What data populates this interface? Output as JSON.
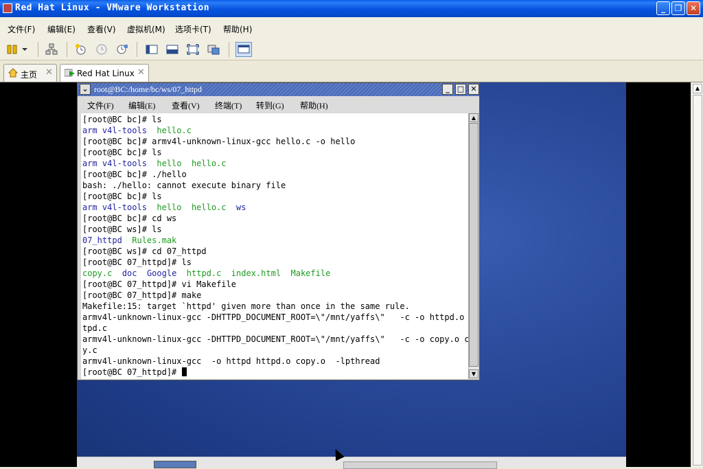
{
  "window": {
    "title": "Red Hat Linux - VMware Workstation",
    "minimize": "_",
    "maximize": "❐",
    "close": "✕"
  },
  "menubar": [
    "文件(F)",
    "编辑(E)",
    "查看(V)",
    "虚拟机(M)",
    "选项卡(T)",
    "帮助(H)"
  ],
  "tabs": [
    {
      "label": "主页",
      "icon": "home-icon",
      "close": "✕"
    },
    {
      "label": "Red Hat Linux",
      "icon": "play-icon",
      "close": "✕"
    }
  ],
  "terminal": {
    "title": "root@BC:/home/bc/ws/07_httpd",
    "menu": [
      "文件(F)",
      "编辑(E)",
      "查看(V)",
      "终端(T)",
      "转到(G)",
      "帮助(H)"
    ],
    "lines": [
      [
        {
          "t": "[root@BC bc]# ls",
          "c": ""
        }
      ],
      [
        {
          "t": "arm v4l-tools",
          "c": "dir"
        },
        {
          "t": "  ",
          "c": ""
        },
        {
          "t": "hello.c",
          "c": "file"
        }
      ],
      [
        {
          "t": "[root@BC bc]# armv4l-unknown-linux-gcc hello.c -o hello",
          "c": ""
        }
      ],
      [
        {
          "t": "[root@BC bc]# ls",
          "c": ""
        }
      ],
      [
        {
          "t": "arm v4l-tools",
          "c": "dir"
        },
        {
          "t": "  ",
          "c": ""
        },
        {
          "t": "hello",
          "c": "exe"
        },
        {
          "t": "  ",
          "c": ""
        },
        {
          "t": "hello.c",
          "c": "file"
        }
      ],
      [
        {
          "t": "[root@BC bc]# ./hello",
          "c": ""
        }
      ],
      [
        {
          "t": "bash: ./hello: cannot execute binary file",
          "c": ""
        }
      ],
      [
        {
          "t": "[root@BC bc]# ls",
          "c": ""
        }
      ],
      [
        {
          "t": "arm v4l-tools",
          "c": "dir"
        },
        {
          "t": "  ",
          "c": ""
        },
        {
          "t": "hello",
          "c": "exe"
        },
        {
          "t": "  ",
          "c": ""
        },
        {
          "t": "hello.c",
          "c": "file"
        },
        {
          "t": "  ",
          "c": ""
        },
        {
          "t": "ws",
          "c": "dir"
        }
      ],
      [
        {
          "t": "[root@BC bc]# cd ws",
          "c": ""
        }
      ],
      [
        {
          "t": "[root@BC ws]# ls",
          "c": ""
        }
      ],
      [
        {
          "t": "07_httpd",
          "c": "dir"
        },
        {
          "t": "  ",
          "c": ""
        },
        {
          "t": "Rules.mak",
          "c": "file"
        }
      ],
      [
        {
          "t": "[root@BC ws]# cd 07_httpd",
          "c": ""
        }
      ],
      [
        {
          "t": "[root@BC 07_httpd]# ls",
          "c": ""
        }
      ],
      [
        {
          "t": "copy.c",
          "c": "file"
        },
        {
          "t": "  ",
          "c": ""
        },
        {
          "t": "doc",
          "c": "dir"
        },
        {
          "t": "  ",
          "c": ""
        },
        {
          "t": "Google",
          "c": "dir"
        },
        {
          "t": "  ",
          "c": ""
        },
        {
          "t": "httpd.c",
          "c": "file"
        },
        {
          "t": "  ",
          "c": ""
        },
        {
          "t": "index.html",
          "c": "file"
        },
        {
          "t": "  ",
          "c": ""
        },
        {
          "t": "Makefile",
          "c": "file"
        }
      ],
      [
        {
          "t": "[root@BC 07_httpd]# vi Makefile",
          "c": ""
        }
      ],
      [
        {
          "t": "[root@BC 07_httpd]# make",
          "c": ""
        }
      ],
      [
        {
          "t": "Makefile:15: target `httpd' given more than once in the same rule.",
          "c": ""
        }
      ],
      [
        {
          "t": "armv4l-unknown-linux-gcc -DHTTPD_DOCUMENT_ROOT=\\\"/mnt/yaffs\\\"   -c -o httpd.o ht",
          "c": ""
        }
      ],
      [
        {
          "t": "tpd.c",
          "c": ""
        }
      ],
      [
        {
          "t": "armv4l-unknown-linux-gcc -DHTTPD_DOCUMENT_ROOT=\\\"/mnt/yaffs\\\"   -c -o copy.o cop",
          "c": ""
        }
      ],
      [
        {
          "t": "y.c",
          "c": ""
        }
      ],
      [
        {
          "t": "armv4l-unknown-linux-gcc  -o httpd httpd.o copy.o  -lpthread",
          "c": ""
        }
      ],
      [
        {
          "t": "[root@BC 07_httpd]# ",
          "c": ""
        }
      ]
    ]
  },
  "colors": {
    "titlebar": "#0653e0",
    "dir": "#2323a0",
    "file": "#1f9a1f"
  }
}
